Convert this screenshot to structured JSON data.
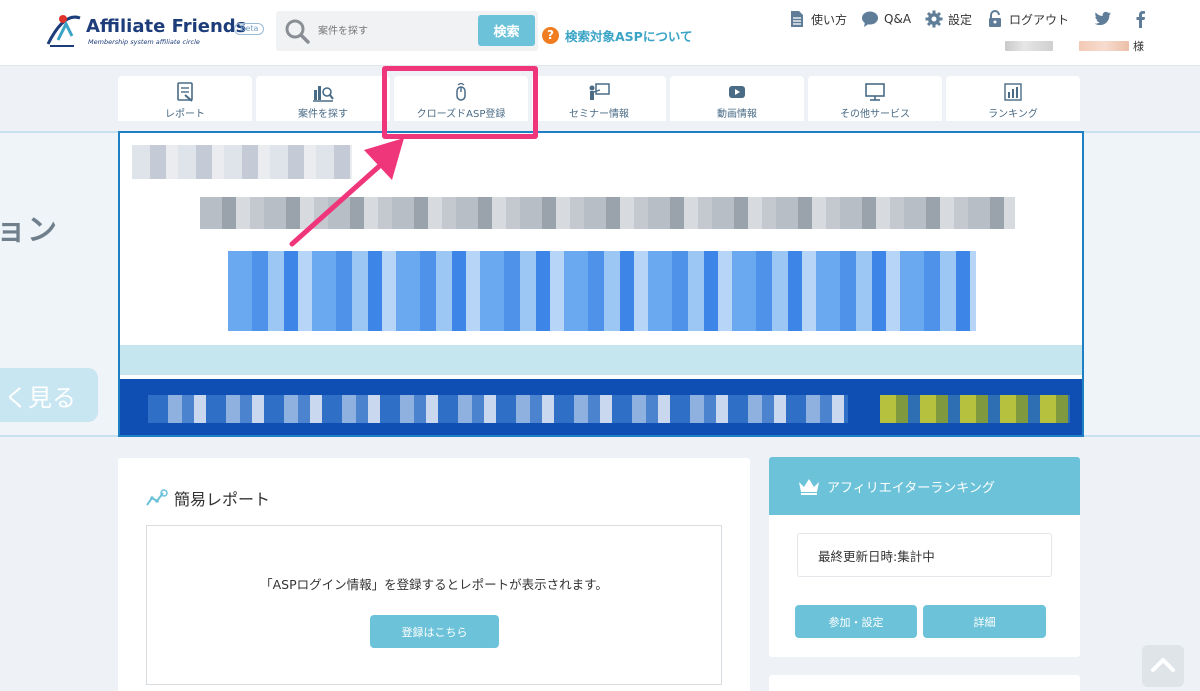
{
  "header": {
    "logo_text": "Affiliate Friends",
    "logo_sub": "Membership system affiliate circle",
    "logo_badge": "Beta",
    "search_placeholder": "案件を探す",
    "search_button": "検索",
    "asp_help_text": "検索対象ASPについて",
    "nav": [
      {
        "label": "使い方",
        "icon": "document-icon"
      },
      {
        "label": "Q&A",
        "icon": "speech-bubble-icon"
      },
      {
        "label": "設定",
        "icon": "gear-icon"
      },
      {
        "label": "ログアウト",
        "icon": "lock-icon"
      }
    ],
    "user_suffix": "様"
  },
  "tabs": [
    {
      "label": "レポート",
      "icon": "report-icon"
    },
    {
      "label": "案件を探す",
      "icon": "search-chart-icon"
    },
    {
      "label": "クローズドASP登録",
      "icon": "mouse-icon"
    },
    {
      "label": "セミナー情報",
      "icon": "seminar-icon"
    },
    {
      "label": "動画情報",
      "icon": "play-icon"
    },
    {
      "label": "その他サービス",
      "icon": "monitor-icon"
    },
    {
      "label": "ランキング",
      "icon": "bar-chart-icon"
    }
  ],
  "side": {
    "partial_heading": "ョン",
    "partial_button": "く見る"
  },
  "report": {
    "title": "簡易レポート",
    "message": "「ASPログイン情報」を登録するとレポートが表示されます。",
    "button": "登録はこちら"
  },
  "ranking": {
    "title": "アフィリエイターランキング",
    "updated": "最終更新日時:集計中",
    "join_button": "参加・設定",
    "detail_button": "詳細"
  },
  "colors": {
    "accent": "#6cc3d9",
    "highlight": "#f0367a",
    "link": "#3aa4c6",
    "brand": "#1c3c7a"
  }
}
